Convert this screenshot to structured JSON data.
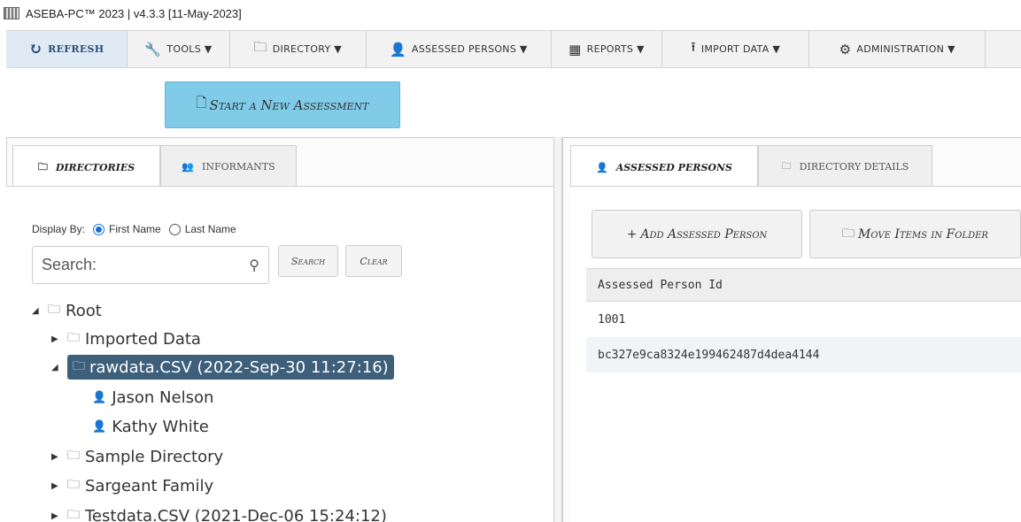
{
  "window": {
    "title": "ASEBA-PC™ 2023 | v4.3.3 [11-May-2023]"
  },
  "toolbar": {
    "refresh": "REFRESH",
    "tools": "TOOLS ▼",
    "directory": "DIRECTORY ▼",
    "assessed_persons": "ASSESSED PERSONS ▼",
    "reports": "REPORTS ▼",
    "import_data": "IMPORT DATA ▼",
    "administration": "ADMINISTRATION ▼"
  },
  "start_button": "Start a New Assessment",
  "left_tabs": {
    "directories": "DIRECTORIES",
    "informants": "INFORMANTS"
  },
  "display_by": {
    "label": "Display By:",
    "first_name": "First Name",
    "last_name": "Last Name",
    "selected": "First Name"
  },
  "search": {
    "placeholder": "Search:",
    "search_button": "Search",
    "clear_button": "Clear"
  },
  "tree": {
    "root": "Root",
    "items": [
      "Imported Data",
      "rawdata.CSV (2022-Sep-30 11:27:16)",
      "Jason Nelson",
      "Kathy White",
      "Sample Directory",
      "Sargeant Family",
      "Testdata.CSV (2021-Dec-06 15:24:12)"
    ]
  },
  "right_tabs": {
    "assessed_persons": "ASSESSED PERSONS",
    "directory_details": "DIRECTORY DETAILS"
  },
  "actions": {
    "add_person": "Add Assessed Person",
    "move_items": "Move Items in Folder"
  },
  "table": {
    "header": "Assessed Person Id",
    "rows": [
      "1001",
      "bc327e9ca8324e199462487d4dea4144"
    ]
  },
  "colors": {
    "accent": "#7fcbe8",
    "selected": "#3d5f7a",
    "refresh_bg": "#dfeaf5"
  }
}
